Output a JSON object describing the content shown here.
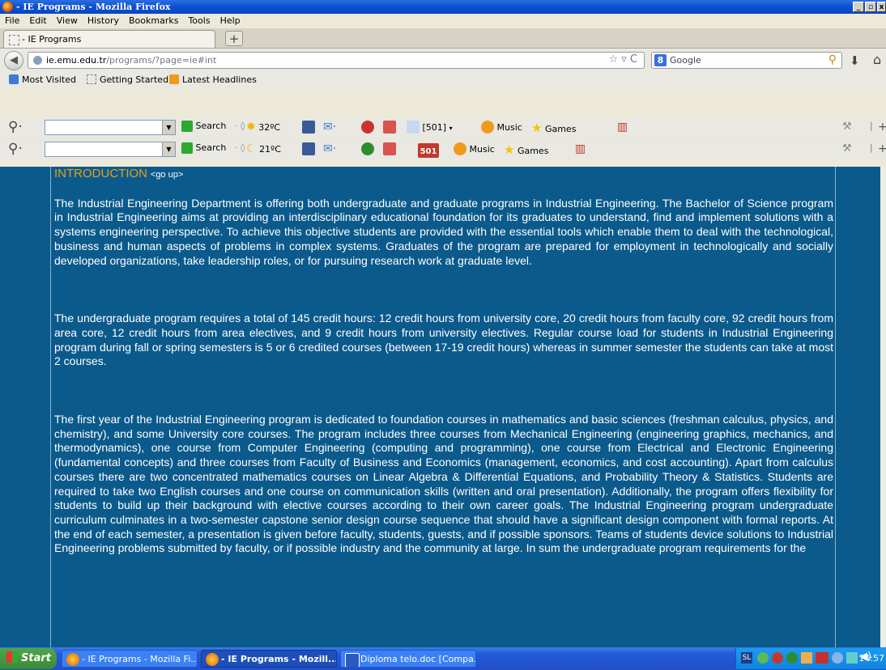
{
  "window": {
    "title": "- IE Programs - Mozilla Firefox"
  },
  "menu": [
    "File",
    "Edit",
    "View",
    "History",
    "Bookmarks",
    "Tools",
    "Help"
  ],
  "tab": {
    "label": "- IE Programs",
    "new_tab": "+"
  },
  "nav": {
    "url_host": "ie.emu.edu.tr",
    "url_path": "/programs/?page=ie#int",
    "url_controls": "☆ ▿ C",
    "search_engine": "8",
    "search_placeholder": "Google"
  },
  "bookmarks": [
    "Most Visited",
    "Getting Started",
    "Latest Headlines"
  ],
  "toolbar1": {
    "search": "Search",
    "weather": "32ºC",
    "count": "[501]",
    "music": "Music",
    "games": "Games"
  },
  "toolbar2": {
    "search": "Search",
    "weather": "21ºC",
    "badge": "501",
    "music": "Music",
    "games": "Games"
  },
  "page": {
    "heading": "INTRODUCTION",
    "go_up": "<go up>",
    "paragraphs": [
      "The Industrial Engineering Department is offering both undergraduate and graduate programs in Industrial Engineering. The Bachelor of Science program in Industrial Engineering aims at providing an interdisciplinary educational foundation for its graduates to understand, find and implement solutions with a systems engineering perspective. To achieve this objective students are provided with the essential tools which enable them to deal with the technological, business and human aspects of problems in complex systems. Graduates of the program are prepared for employment in technologically and socially developed organizations, take leadership roles, or for pursuing research work at graduate level.",
      "The undergraduate program requires a total of 145 credit hours: 12 credit hours from university core, 20 credit hours from faculty core, 92 credit hours from area core, 12 credit hours from area electives, and 9 credit hours from university electives. Regular course load for students in Industrial Engineering program during fall or spring semesters is 5 or 6 credited courses (between 17-19 credit hours) whereas in summer semester the students can take at most 2 courses.",
      "The first year of the Industrial Engineering program is dedicated to foundation courses in mathematics and basic sciences (freshman calculus, physics, and chemistry), and some University core courses. The program includes three courses from Mechanical Engineering (engineering graphics, mechanics, and thermodynamics), one course from Computer Engineering (computing and programming), one course from Electrical and Electronic Engineering (fundamental concepts) and three courses from Faculty of Business and Economics (management, economics, and cost accounting). Apart from calculus courses there are two concentrated mathematics courses on Linear Algebra & Differential Equations, and Probability Theory & Statistics. Students are required to take two English courses and one course on communication skills (written and oral presentation). Additionally, the program offers flexibility for students to build up their background with elective courses according to their own career goals. The Industrial Engineering program undergraduate curriculum culminates in a two-semester capstone senior design course sequence that should have a significant design component with formal reports. At the end of each semester, a presentation is given before faculty, students, guests, and if possible sponsors. Teams of students device solutions to Industrial Engineering problems submitted by faculty, or if possible industry and the community at large. In sum the undergraduate program requirements for the"
    ]
  },
  "taskbar": {
    "start": "Start",
    "buttons": [
      "- IE Programs - Mozilla Fi...",
      "- IE Programs - Mozill...",
      "Diploma telo.doc [Compa..."
    ],
    "clock": "14:57"
  },
  "colors": {
    "page_bg": "#0b5a8c",
    "heading": "#e7a01c",
    "titlebar": "#0a4fd0",
    "taskbar": "#2359d6"
  }
}
